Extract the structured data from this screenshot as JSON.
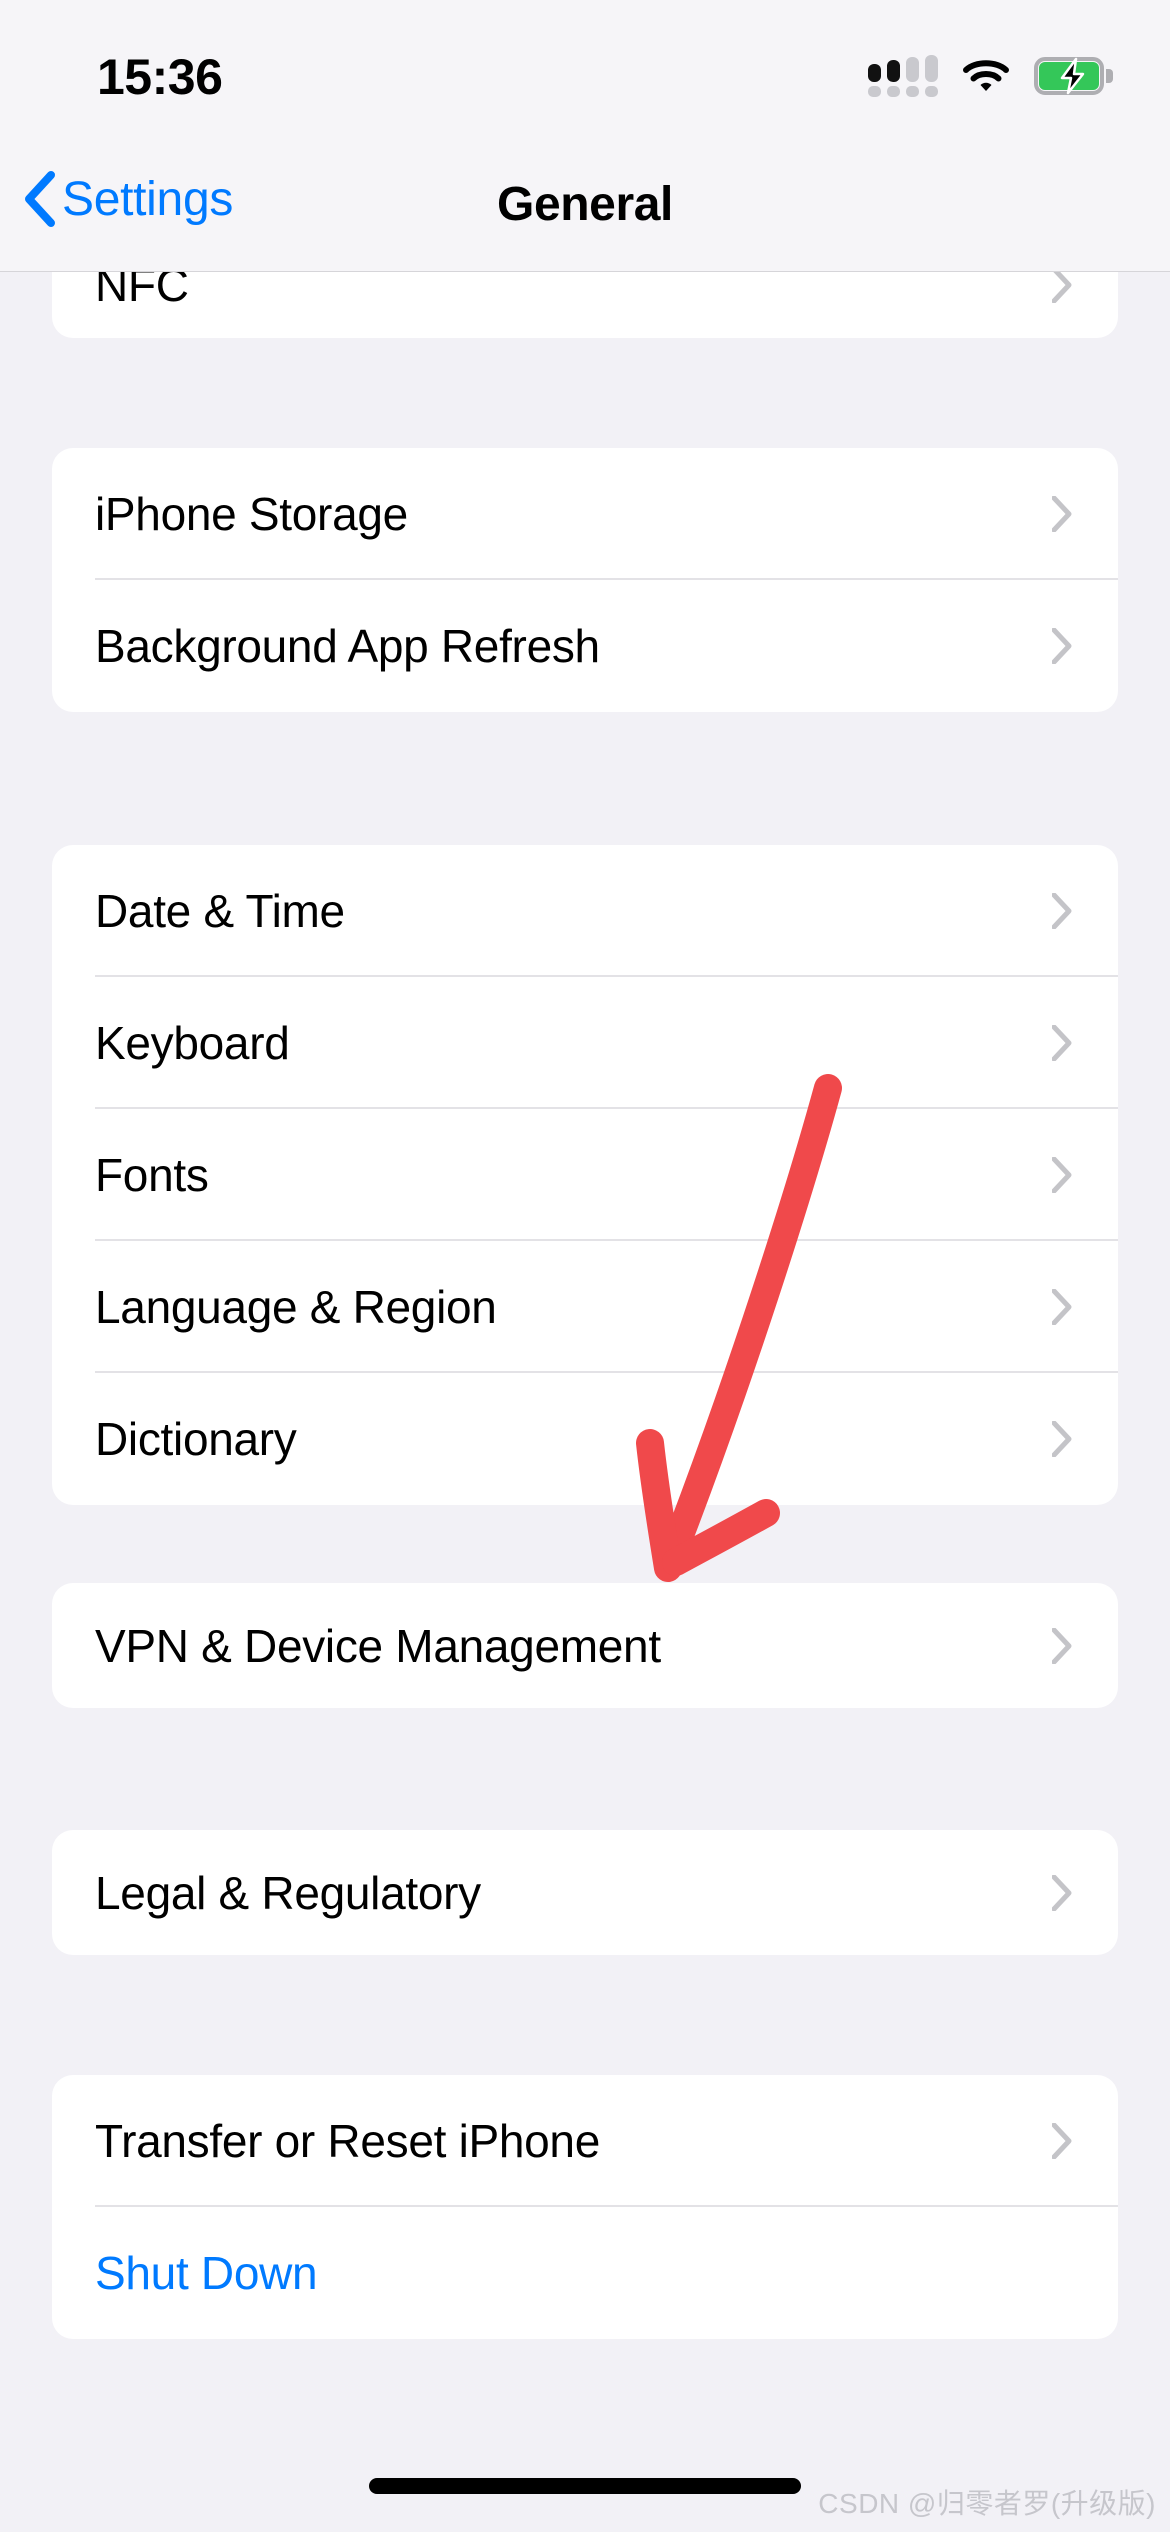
{
  "status_bar": {
    "time": "15:36",
    "cellular_icon": "cellular-signal-icon",
    "cellular_bars_filled": 2,
    "cellular_bars_total": 4,
    "wifi_icon": "wifi-icon",
    "battery_icon": "battery-charging-icon",
    "battery_charging": true,
    "colors": {
      "battery_fill": "#34C759",
      "signal_active": "#111111",
      "signal_inactive": "#C9C9CE"
    }
  },
  "nav_bar": {
    "back_label": "Settings",
    "back_icon": "chevron-left-icon",
    "title": "General",
    "accent_color": "#007AFF"
  },
  "groups": [
    {
      "name": "group-nfc",
      "rows": [
        {
          "label": "NFC",
          "accessory": "chevron-right-icon",
          "style": "default"
        }
      ]
    },
    {
      "name": "group-storage",
      "rows": [
        {
          "label": "iPhone Storage",
          "accessory": "chevron-right-icon",
          "style": "default"
        },
        {
          "label": "Background App Refresh",
          "accessory": "chevron-right-icon",
          "style": "default"
        }
      ]
    },
    {
      "name": "group-localization",
      "rows": [
        {
          "label": "Date & Time",
          "accessory": "chevron-right-icon",
          "style": "default"
        },
        {
          "label": "Keyboard",
          "accessory": "chevron-right-icon",
          "style": "default"
        },
        {
          "label": "Fonts",
          "accessory": "chevron-right-icon",
          "style": "default"
        },
        {
          "label": "Language & Region",
          "accessory": "chevron-right-icon",
          "style": "default"
        },
        {
          "label": "Dictionary",
          "accessory": "chevron-right-icon",
          "style": "default"
        }
      ]
    },
    {
      "name": "group-vpn",
      "rows": [
        {
          "label": "VPN & Device Management",
          "accessory": "chevron-right-icon",
          "style": "default"
        }
      ]
    },
    {
      "name": "group-legal",
      "rows": [
        {
          "label": "Legal & Regulatory",
          "accessory": "chevron-right-icon",
          "style": "default"
        }
      ]
    },
    {
      "name": "group-reset",
      "rows": [
        {
          "label": "Transfer or Reset iPhone",
          "accessory": "chevron-right-icon",
          "style": "default"
        },
        {
          "label": "Shut Down",
          "accessory": "none",
          "style": "blue"
        }
      ]
    }
  ],
  "annotation": {
    "type": "hand-drawn-arrow",
    "color": "#F0494B",
    "points_to": "VPN & Device Management"
  },
  "home_indicator": "home-indicator",
  "watermark": "CSDN @归零者罗(升级版)",
  "colors": {
    "page_background": "#F2F1F6",
    "card_background": "#FFFFFF",
    "separator": "#E3E2E6",
    "chevron": "#C4C4C8",
    "primary_text": "#000000",
    "accent_blue": "#007AFF"
  }
}
